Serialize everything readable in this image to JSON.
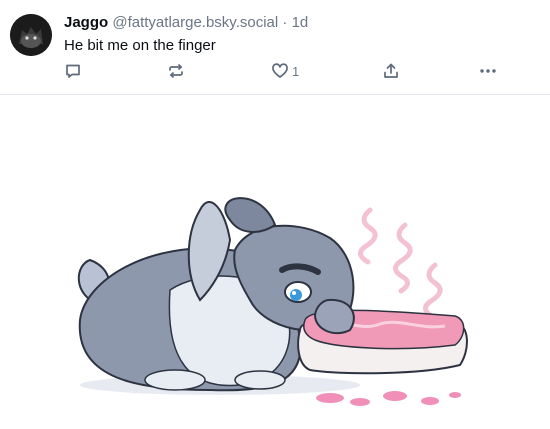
{
  "post": {
    "author_name": "Jaggo",
    "author_handle": "@fattyatlarge.bsky.social",
    "separator": "·",
    "time": "1d",
    "text": "He bit me on the finger",
    "actions": {
      "reply_icon": "reply-icon",
      "repost_icon": "repost-icon",
      "like_icon": "heart-icon",
      "like_count": "1",
      "share_icon": "share-icon",
      "more_icon": "more-icon"
    }
  },
  "colors": {
    "text": "#0b0f14",
    "muted": "#6b7785",
    "divider": "#e3e7ec",
    "fur": "#8e98ad",
    "meat": "#f09ab8"
  }
}
